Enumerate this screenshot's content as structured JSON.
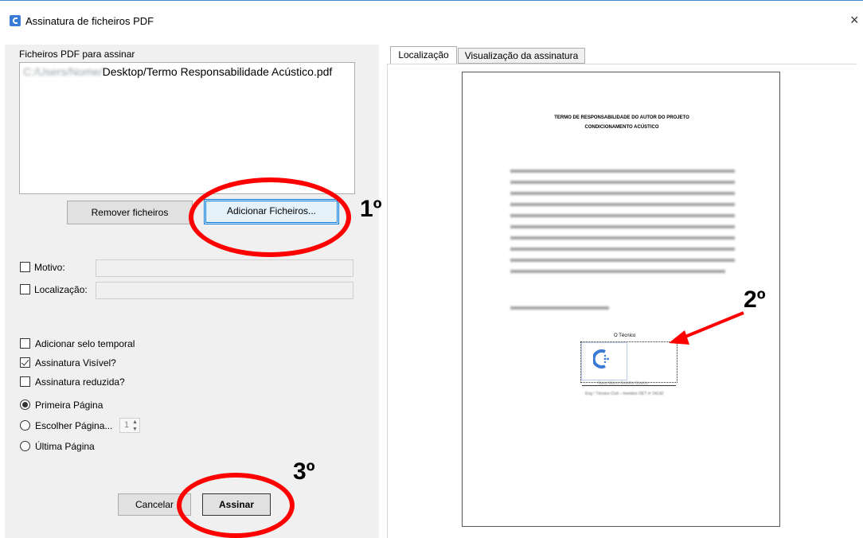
{
  "window": {
    "title": "Assinatura de ficheiros PDF",
    "close_glyph": "×"
  },
  "files": {
    "label": "Ficheiros PDF para assinar",
    "path_hidden": "C:/Users/Nome/",
    "path_visible": "Desktop/Termo Responsabilidade Acústico.pdf",
    "remove_label": "Remover ficheiros",
    "add_label": "Adicionar Ficheiros..."
  },
  "fields": {
    "motivo_label": "Motivo:",
    "motivo_value": "",
    "localizacao_label": "Localização:",
    "localizacao_value": ""
  },
  "options": {
    "timestamp": {
      "label": "Adicionar selo temporal",
      "checked": false
    },
    "visible": {
      "label": "Assinatura Visível?",
      "checked": true
    },
    "reduced": {
      "label": "Assinatura reduzida?",
      "checked": false
    },
    "first_page": {
      "label": "Primeira Página",
      "selected": true
    },
    "choose_page": {
      "label": "Escolher Página...",
      "selected": false,
      "value": "1"
    },
    "last_page": {
      "label": "Última Página",
      "selected": false
    }
  },
  "actions": {
    "cancel_label": "Cancelar",
    "sign_label": "Assinar"
  },
  "tabs": [
    {
      "label": "Localização",
      "active": true
    },
    {
      "label": "Visualização da assinatura",
      "active": false
    }
  ],
  "document": {
    "title_line1": "TERMO DE RESPONSABILIDADE DO AUTOR DO PROJETO",
    "title_line2": "CONDICIONAMENTO ACÚSTICO",
    "signature_caption": "O Técnico",
    "signer_name": "Nuno Marco Botelho Soares",
    "signer_role": "Eng.º Técnico Civil – membro OET nº 24142"
  },
  "annotations": {
    "step1": "1º",
    "step2": "2º",
    "step3": "3º",
    "color": "#ff0000"
  }
}
